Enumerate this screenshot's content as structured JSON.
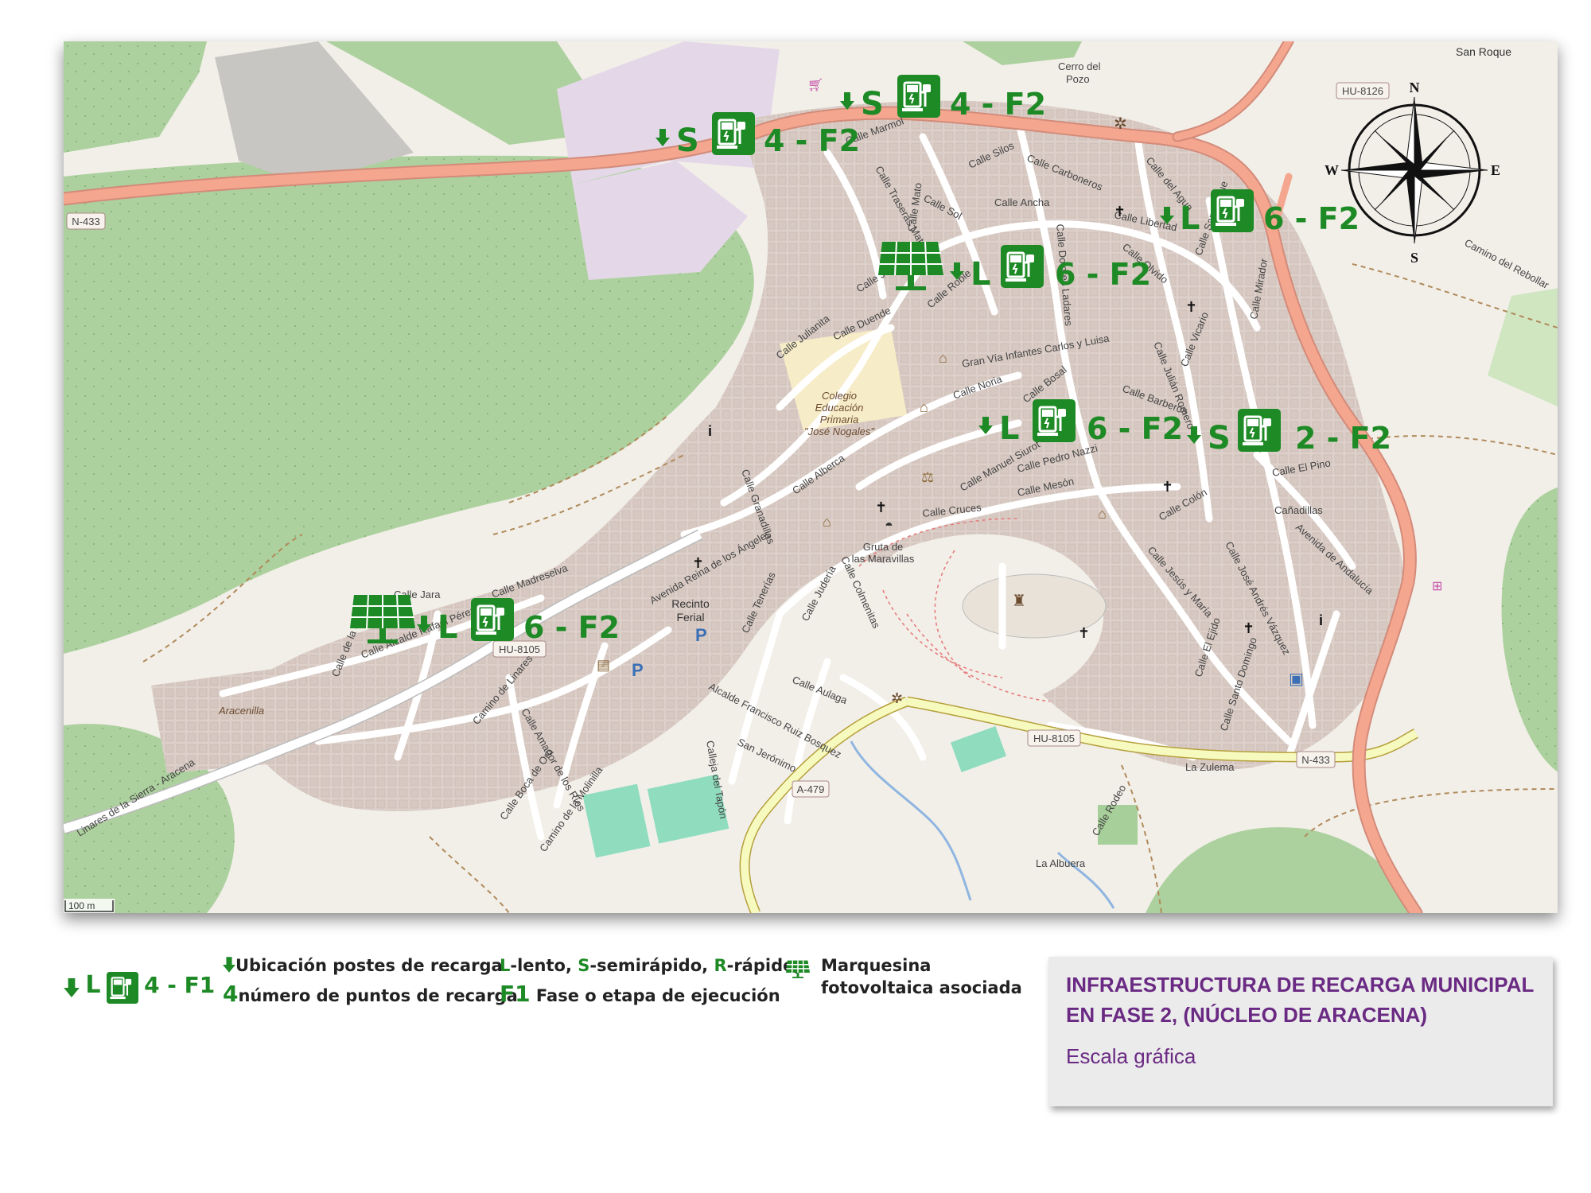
{
  "map": {
    "scale_label": "100 m",
    "roads": {
      "n433_west": "N-433",
      "n433_east": "N-433",
      "hu8126": "HU-8126",
      "hu8105_west": "HU-8105",
      "hu8105_south": "HU-8105",
      "a479": "A-479"
    },
    "places": {
      "san_roque": "San Roque",
      "cerro_del_pozo": "Cerro del\nPozo",
      "colegio": "Colegio\nEducación\nPrimaria\n\"José Nogales\"",
      "gruta": "Gruta de\nlas Maravillas",
      "recinto_ferial": "Recinto\nFerial",
      "aracenilla": "Aracenilla",
      "la_zulema": "La Zulema",
      "la_albuera": "La Albuera",
      "camino_rebollar": "Camino del Rebollar"
    },
    "streets": [
      "Calle Silos",
      "Calle Carboneros",
      "Calle del Agua",
      "Calle Ancha",
      "Calle Libertad",
      "Calle Sol",
      "Calle Mato",
      "Calle Traseras Mato",
      "Calle Dolores Ladares",
      "Calle Olvido",
      "Calle San Roque",
      "Calle Julianita",
      "Calle Duende",
      "Calle Julia",
      "Calle Roble",
      "Gran Vía Infantes Carlos y Luisa",
      "Calle Noria",
      "Calle Bosal",
      "Calle Barberos",
      "Calle Julián Romero",
      "Calle Vicario",
      "Calle Mirador",
      "Calle Alberca",
      "Calle Granadillas",
      "Calle Manuel Siurot",
      "Calle Pedro Nazzi",
      "Calle Mesón",
      "Calle Cruces",
      "Calle Colón",
      "Calle El Pino",
      "Cañadillas",
      "Avenida de Andalucía",
      "Calle José Andrés Vázquez",
      "Calle Jesús y María",
      "Avenida Reina de los Ángeles",
      "Calle Madreselva",
      "Calle Jara",
      "Calle Alcalde Rafael Pérez",
      "Calle de la Sierra",
      "Camino de Linares",
      "Calle Amador de los Ríos",
      "Calle Boca de Oro",
      "Camino de la Molinilla",
      "Calle Tenerías",
      "Calle Judería",
      "Calle Colmenitas",
      "Calle Aulaga",
      "Alcalde Francisco Ruiz Bosquez",
      "San Jerónimo",
      "Calleja del Tapón",
      "Calle El Ejido",
      "Calle Santo Domingo",
      "Calle Rodeo",
      "Linares de la Sierra - Aracena",
      "Calle Marmol"
    ],
    "compass": {
      "n": "N",
      "s": "S",
      "e": "E",
      "w": "W"
    },
    "markers": [
      {
        "type": "S",
        "count": "4 - F2",
        "solar": false
      },
      {
        "type": "S",
        "count": "4 - F2",
        "solar": false
      },
      {
        "type": "L",
        "count": "6 - F2",
        "solar": false
      },
      {
        "type": "L",
        "count": "6 - F2",
        "solar": true
      },
      {
        "type": "L",
        "count": "6 - F2",
        "solar": false
      },
      {
        "type": "S",
        "count": "2 - F2",
        "solar": false
      },
      {
        "type": "L",
        "count": "6 - F2",
        "solar": true
      }
    ]
  },
  "legend": {
    "example_type": "L",
    "example_count": "4 - F1",
    "line1_text": "Ubicación postes de recarga",
    "line2_num": "4",
    "line2_text": "número de puntos de recarga",
    "speed_L": "L",
    "speed_L_text": "-lento, ",
    "speed_S": "S",
    "speed_S_text": "-semirápido, ",
    "speed_R": "R",
    "speed_R_text": "-rápido,",
    "phase_code": "F1",
    "phase_text": " Fase o etapa de ejecución",
    "solar_text": "Marquesina fotovoltaica asociada"
  },
  "info_box": {
    "title": "INFRAESTRUCTURA DE RECARGA MUNICIPAL EN FASE 2, (NÚCLEO DE ARACENA)",
    "scale_label": "Escala gráfica"
  },
  "colors": {
    "marker_green": "#1e8a25",
    "road_primary": "#f09a85",
    "road_secondary": "#f4f0a8",
    "forest": "#add19e",
    "title_purple": "#6a2a83"
  }
}
